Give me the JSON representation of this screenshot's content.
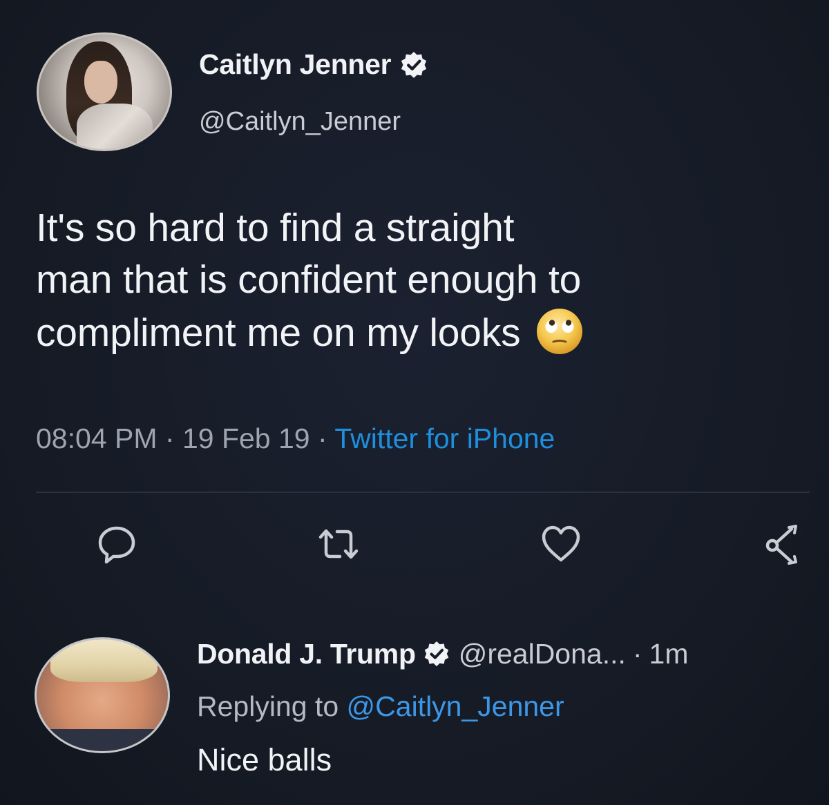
{
  "tweet": {
    "author": {
      "display_name": "Caitlyn Jenner",
      "handle": "@Caitlyn_Jenner",
      "verified": true
    },
    "text_lines": [
      "It's so hard to find a straight",
      "man that is confident enough to",
      "compliment me on my looks"
    ],
    "emoji": "face-with-rolling-eyes",
    "time": "08:04 PM",
    "separator": "·",
    "date": "19 Feb 19",
    "source": "Twitter for iPhone",
    "actions": [
      {
        "icon": "reply-icon"
      },
      {
        "icon": "retweet-icon"
      },
      {
        "icon": "like-icon"
      },
      {
        "icon": "share-icon"
      }
    ]
  },
  "reply": {
    "author": {
      "display_name": "Donald J. Trump",
      "handle": "@realDona...",
      "verified": true
    },
    "separator": "·",
    "age": "1m",
    "replying_label": "Replying to",
    "replying_to": "@Caitlyn_Jenner",
    "text": "Nice balls"
  },
  "colors": {
    "background": "#161b26",
    "text": "#f2f3f6",
    "muted": "#9ea4b0",
    "accent": "#1d8fdd",
    "verified_badge": "#ffffff"
  }
}
